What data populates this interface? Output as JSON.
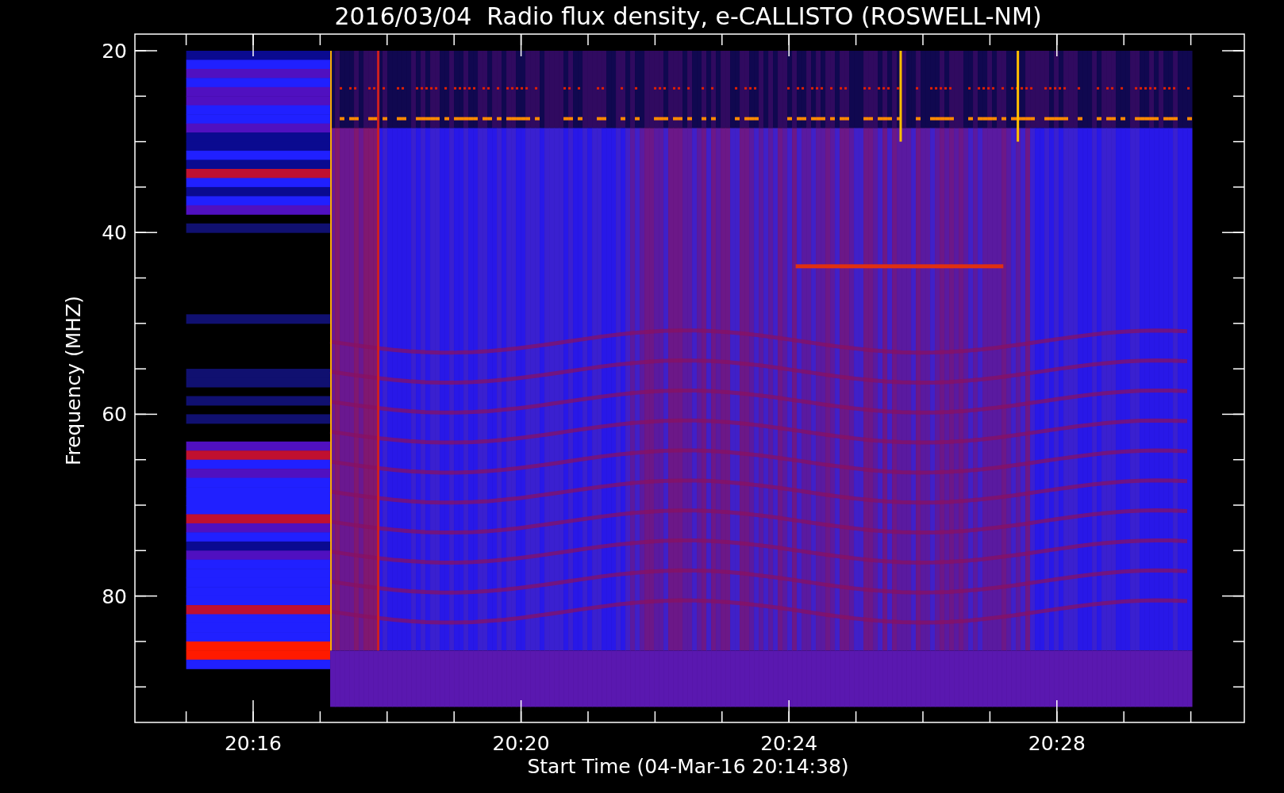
{
  "title": "2016/03/04  Radio flux density, e-CALLISTO (ROSWELL-NM)",
  "y_axis": {
    "label": "Frequency (MHZ)",
    "ticks": [
      "20",
      "40",
      "60",
      "80"
    ]
  },
  "x_axis": {
    "label": "Start Time (04-Mar-16 20:14:38)",
    "ticks": [
      "20:16",
      "20:20",
      "20:24",
      "20:28"
    ]
  }
}
